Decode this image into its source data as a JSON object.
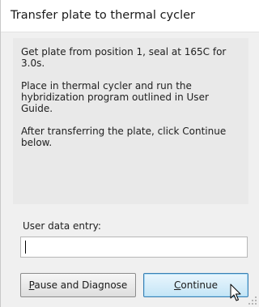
{
  "dialog": {
    "title": "Transfer plate to thermal cycler",
    "instructions": [
      "Get plate from position 1, seal at 165C for 3.0s.",
      "Place in thermal cycler and run the hybridization program outlined in User Guide.",
      "After transferring the plate, click Continue below."
    ],
    "user_entry": {
      "label": "User data entry:",
      "value": "",
      "placeholder": ""
    },
    "buttons": {
      "pause": {
        "mnemonic": "P",
        "rest": "ause and Diagnose"
      },
      "continue": {
        "mnemonic": "C",
        "rest": "ontinue"
      }
    }
  },
  "colors": {
    "dialog_bg": "#f0f0f0",
    "instructions_bg": "#e9e9e9",
    "continue_border": "#3c7fb1",
    "continue_bg": "#c4e5f6"
  },
  "icons": {
    "cursor": "mouse-pointer-icon",
    "grip": "resize-grip-icon"
  }
}
